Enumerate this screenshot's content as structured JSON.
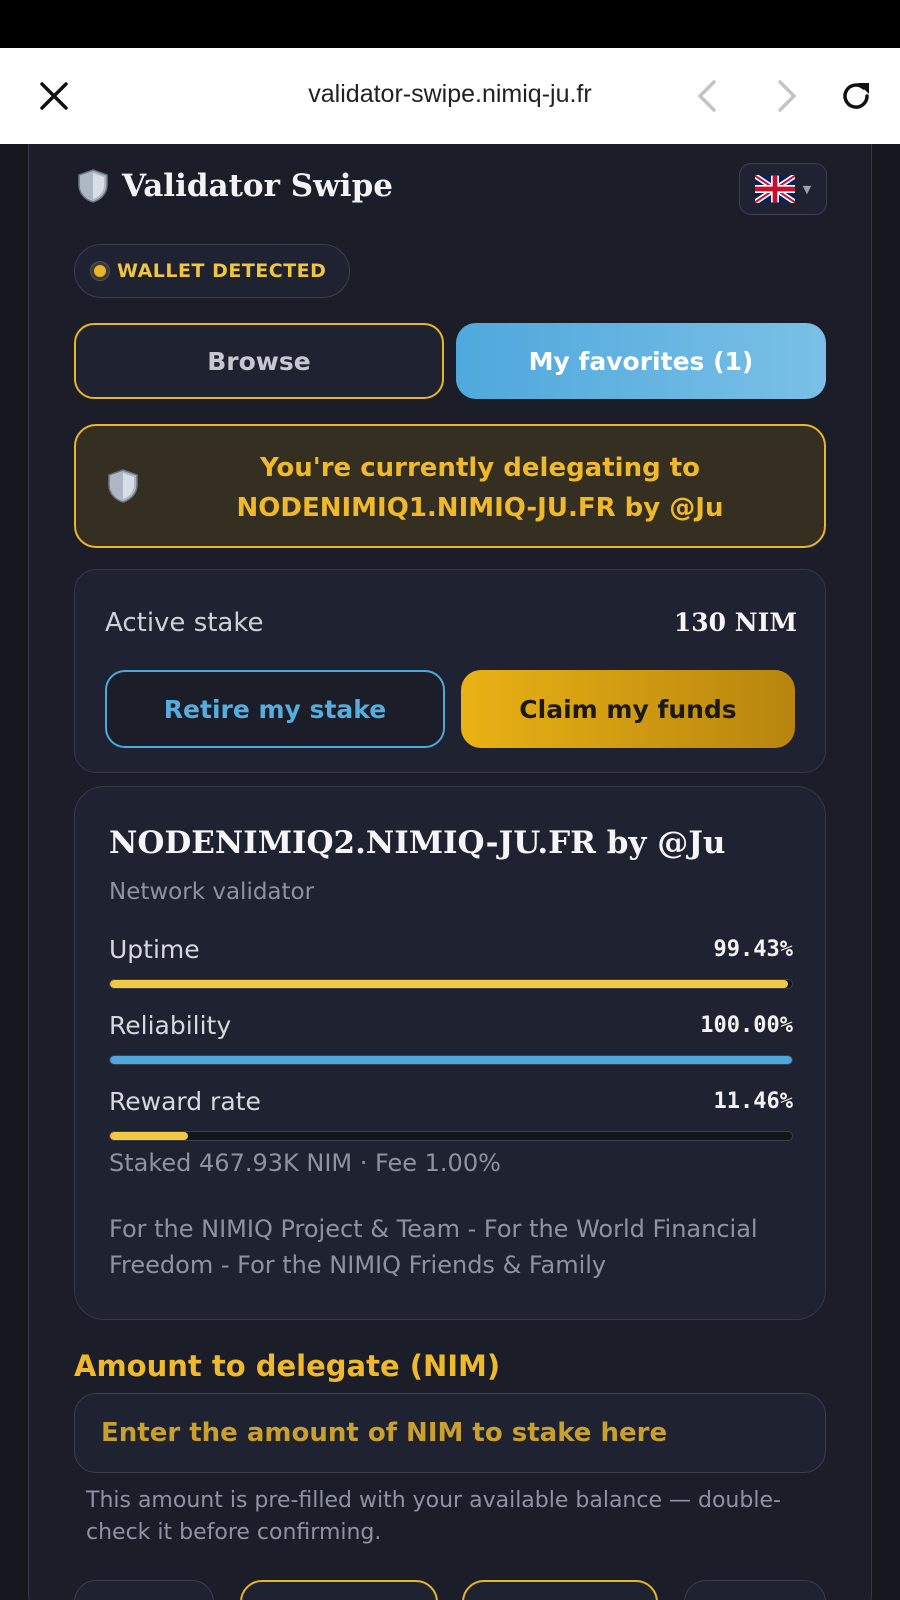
{
  "browser": {
    "url": "validator-swipe.nimiq-ju.fr",
    "close_icon": "close-icon",
    "back_icon": "chevron-left-icon",
    "forward_icon": "chevron-right-icon",
    "reload_icon": "reload-icon"
  },
  "header": {
    "app_title": "Validator Swipe",
    "logo_icon": "shield-icon",
    "language_icon": "uk-flag-icon"
  },
  "wallet_badge": {
    "label": "WALLET DETECTED",
    "color": "#e9b52a"
  },
  "tabs": [
    {
      "label": "Browse",
      "active": false
    },
    {
      "label": "My favorites (1)",
      "active": true
    }
  ],
  "delegation_banner": {
    "text": "You're currently delegating to NODENIMIQ1.NIMIQ-JU.FR by @Ju",
    "icon": "shield-icon"
  },
  "stake": {
    "label": "Active stake",
    "value": "130 NIM",
    "retire_label": "Retire my stake",
    "claim_label": "Claim my funds"
  },
  "validator": {
    "name": "NODENIMIQ2.NIMIQ-JU.FR by @Ju",
    "subtitle": "Network validator",
    "metrics": [
      {
        "label": "Uptime",
        "value": "99.43%",
        "percent": 99.43,
        "color": "#f2c744"
      },
      {
        "label": "Reliability",
        "value": "100.00%",
        "percent": 100,
        "color": "#4fa8dc"
      },
      {
        "label": "Reward rate",
        "value": "11.46%",
        "percent": 11.46,
        "color": "#f2c744"
      }
    ],
    "meta": "Staked 467.93K NIM · Fee 1.00%",
    "description": "For the NIMIQ Project & Team - For the World Financial Freedom - For the NIMIQ Friends & Family"
  },
  "delegate": {
    "label": "Amount to delegate (NIM)",
    "placeholder": "Enter the amount of NIM to stake here",
    "hint": "This amount is pre-filled with your available balance — double-check it before confirming."
  },
  "colors": {
    "accent_gold": "#e9b52a",
    "accent_blue": "#4fa8dc",
    "background": "#15171f",
    "card": "#1f2230"
  }
}
